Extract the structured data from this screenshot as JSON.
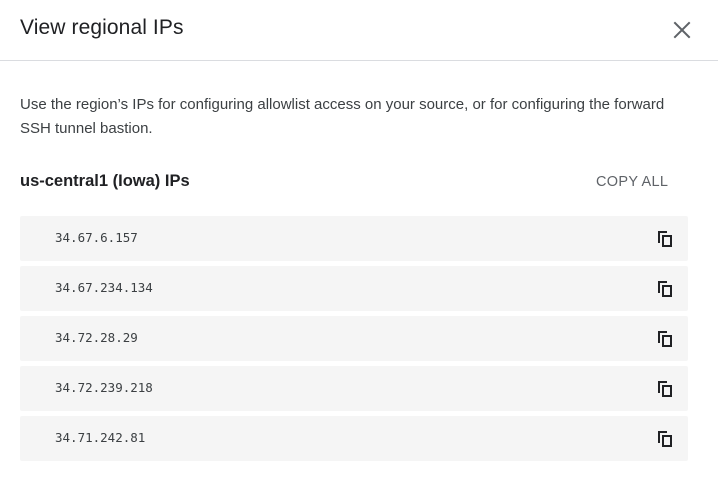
{
  "dialog": {
    "title": "View regional IPs",
    "close_icon": "close-icon"
  },
  "description": "Use the region’s IPs for configuring allowlist access on your source, or for configuring the forward SSH tunnel bastion.",
  "region": {
    "title": "us-central1 (Iowa) IPs",
    "copy_all_label": "COPY ALL",
    "copy_icon": "copy-icon",
    "ips": [
      "34.67.6.157",
      "34.67.234.134",
      "34.72.28.29",
      "34.72.239.218",
      "34.71.242.81"
    ]
  },
  "colors": {
    "row_background": "#f5f5f5",
    "divider": "#dadce0",
    "icon": "#202124",
    "secondary_text": "#5f6368"
  }
}
